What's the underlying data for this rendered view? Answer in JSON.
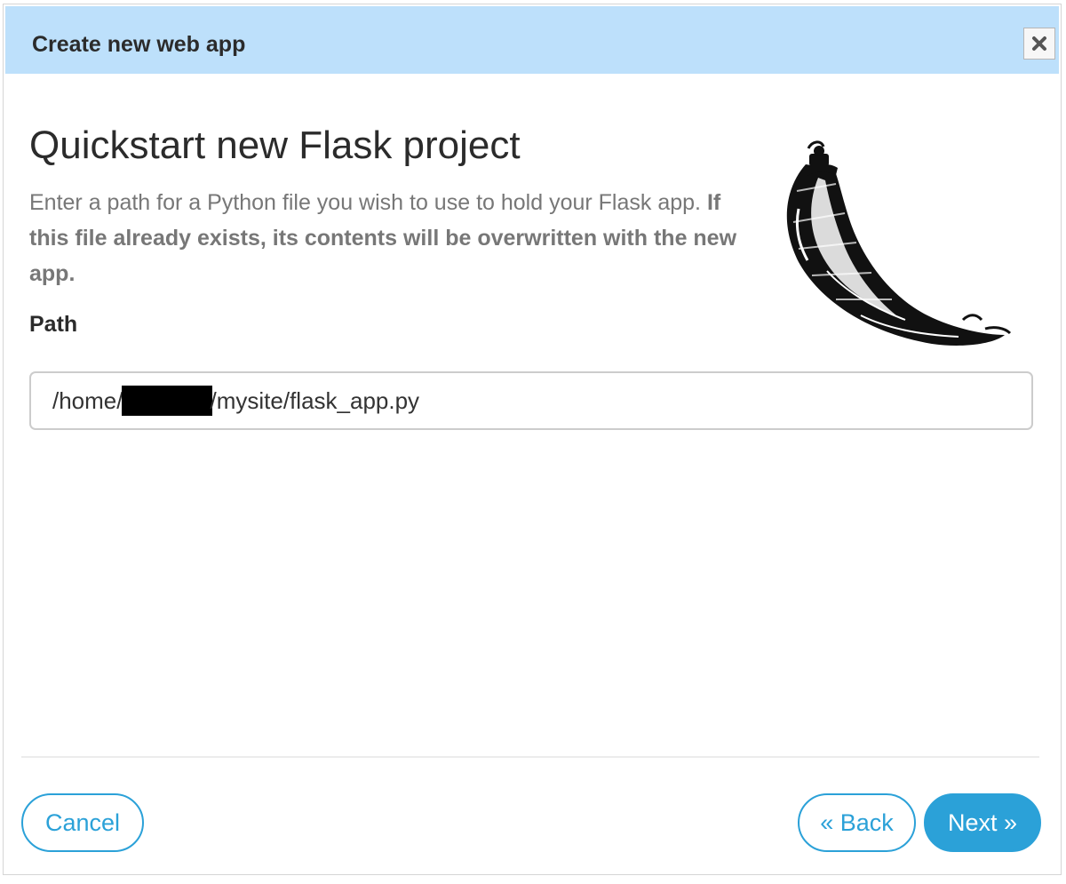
{
  "dialog": {
    "title": "Create new web app",
    "close_icon": "close-icon"
  },
  "content": {
    "heading": "Quickstart new Flask project",
    "description_plain": "Enter a path for a Python file you wish to use to hold your Flask app. ",
    "description_bold": "If this file already exists, its contents will be overwritten with the new app.",
    "logo_icon": "flask-horn-logo"
  },
  "path": {
    "label": "Path",
    "value_prefix": "/home/",
    "value_suffix": "/mysite/flask_app.py"
  },
  "footer": {
    "cancel_label": "Cancel",
    "back_label": "« Back",
    "next_label": "Next »"
  },
  "colors": {
    "header_bg": "#bde0fb",
    "accent": "#2ba1d8",
    "text_dark": "#2b2b2b",
    "text_muted": "#777777"
  }
}
